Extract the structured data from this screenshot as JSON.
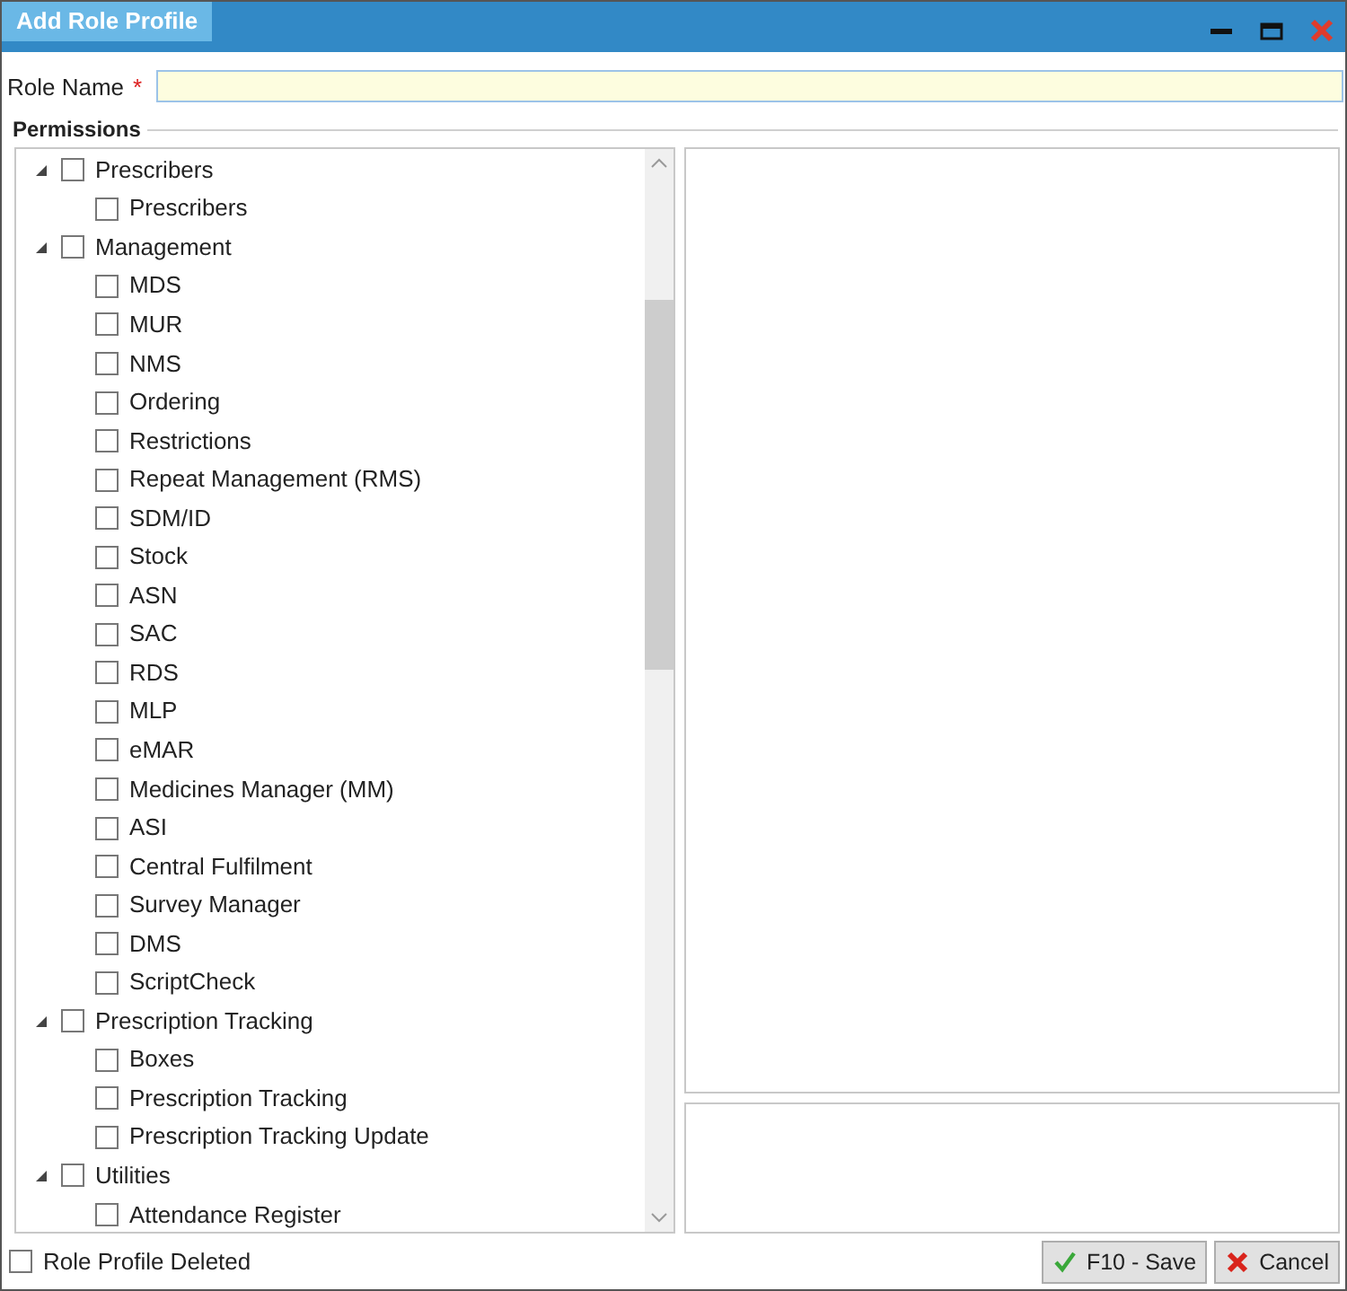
{
  "window": {
    "title": "Add Role Profile"
  },
  "role_name": {
    "label": "Role Name",
    "required_mark": "*"
  },
  "permissions": {
    "title": "Permissions",
    "tree": [
      {
        "label": "Prescribers",
        "checked": false,
        "expanded": true,
        "children": [
          {
            "label": "Prescribers",
            "checked": false
          }
        ]
      },
      {
        "label": "Management",
        "checked": false,
        "expanded": true,
        "children": [
          {
            "label": "MDS",
            "checked": false
          },
          {
            "label": "MUR",
            "checked": false
          },
          {
            "label": "NMS",
            "checked": false
          },
          {
            "label": "Ordering",
            "checked": false
          },
          {
            "label": "Restrictions",
            "checked": false
          },
          {
            "label": "Repeat Management (RMS)",
            "checked": false
          },
          {
            "label": "SDM/ID",
            "checked": false
          },
          {
            "label": "Stock",
            "checked": false
          },
          {
            "label": "ASN",
            "checked": false
          },
          {
            "label": "SAC",
            "checked": false
          },
          {
            "label": "RDS",
            "checked": false
          },
          {
            "label": "MLP",
            "checked": false
          },
          {
            "label": "eMAR",
            "checked": false
          },
          {
            "label": "Medicines Manager (MM)",
            "checked": false
          },
          {
            "label": "ASI",
            "checked": false
          },
          {
            "label": "Central Fulfilment",
            "checked": false
          },
          {
            "label": "Survey Manager",
            "checked": false
          },
          {
            "label": "DMS",
            "checked": false
          },
          {
            "label": "ScriptCheck",
            "checked": false
          }
        ]
      },
      {
        "label": "Prescription Tracking",
        "checked": false,
        "expanded": true,
        "children": [
          {
            "label": "Boxes",
            "checked": false
          },
          {
            "label": "Prescription Tracking",
            "checked": false
          },
          {
            "label": "Prescription Tracking Update",
            "checked": false
          }
        ]
      },
      {
        "label": "Utilities",
        "checked": false,
        "expanded": true,
        "children": [
          {
            "label": "Attendance Register",
            "checked": false
          }
        ]
      }
    ]
  },
  "footer": {
    "deleted": {
      "label": "Role Profile Deleted",
      "checked": false
    },
    "buttons": [
      {
        "kind": "save",
        "label": "F10 - Save"
      },
      {
        "kind": "cancel",
        "label": "Cancel"
      }
    ]
  }
}
